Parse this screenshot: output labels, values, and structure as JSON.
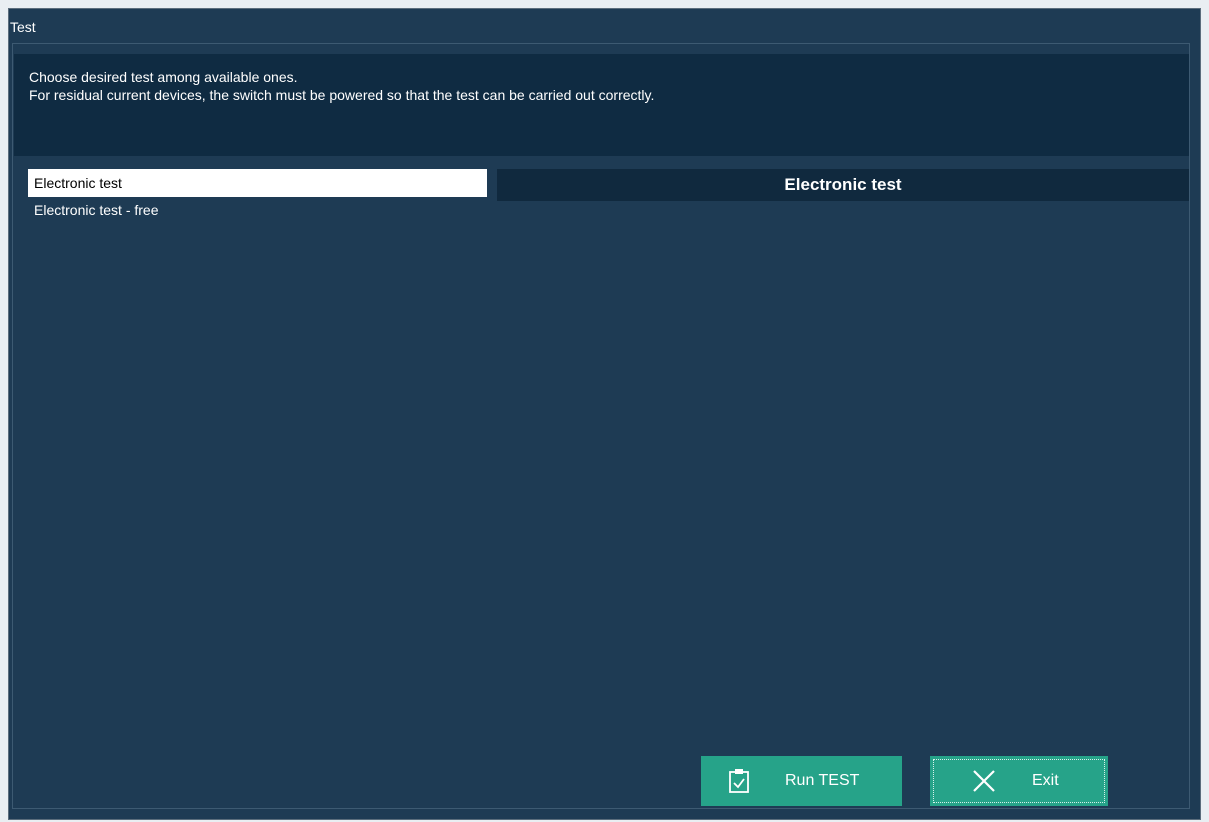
{
  "window": {
    "title": "Test"
  },
  "info": {
    "line1": "Choose desired test among available ones.",
    "line2": "For residual current devices, the switch must be powered so that the test can be carried out correctly."
  },
  "tests": {
    "items": [
      {
        "label": "Electronic test",
        "selected": true
      },
      {
        "label": "Electronic test - free",
        "selected": false
      }
    ]
  },
  "detail": {
    "title": "Electronic test"
  },
  "buttons": {
    "run_label": "Run TEST",
    "run_icon": "clipboard-check-icon",
    "exit_label": "Exit",
    "exit_icon": "close-icon"
  },
  "colors": {
    "background": "#1e3b54",
    "panel": "#0f2b42",
    "accent": "#26a389"
  }
}
